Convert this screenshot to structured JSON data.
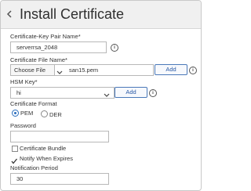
{
  "header": {
    "title": "Install Certificate",
    "back_icon": "chevron-left-icon"
  },
  "form": {
    "keypair": {
      "label": "Certificate-Key Pair Name*",
      "value": "serverrsa_2048"
    },
    "file": {
      "label": "Certificate File Name*",
      "choose_label": "Choose File",
      "chevron_icon": "chevron-down-icon",
      "value": "san15.pem",
      "add_label": "Add"
    },
    "hsm": {
      "label": "HSM Key*",
      "value": "hi",
      "chevron_icon": "chevron-down-icon",
      "add_label": "Add"
    },
    "format": {
      "label": "Certificate Format",
      "options": [
        {
          "label": "PEM",
          "checked": true
        },
        {
          "label": "DER",
          "checked": false
        }
      ]
    },
    "password": {
      "label": "Password",
      "value": ""
    },
    "bundle": {
      "label": "Certificate Bundle",
      "checked": false
    },
    "notify": {
      "label": "Notify When Expires",
      "checked": true
    },
    "period": {
      "label": "Notification Period",
      "value": "30"
    },
    "info_icon": "info-icon"
  },
  "colors": {
    "accent": "#2a6ebd",
    "button_border": "#4a78b8",
    "header_bg": "#f0f0f0"
  }
}
